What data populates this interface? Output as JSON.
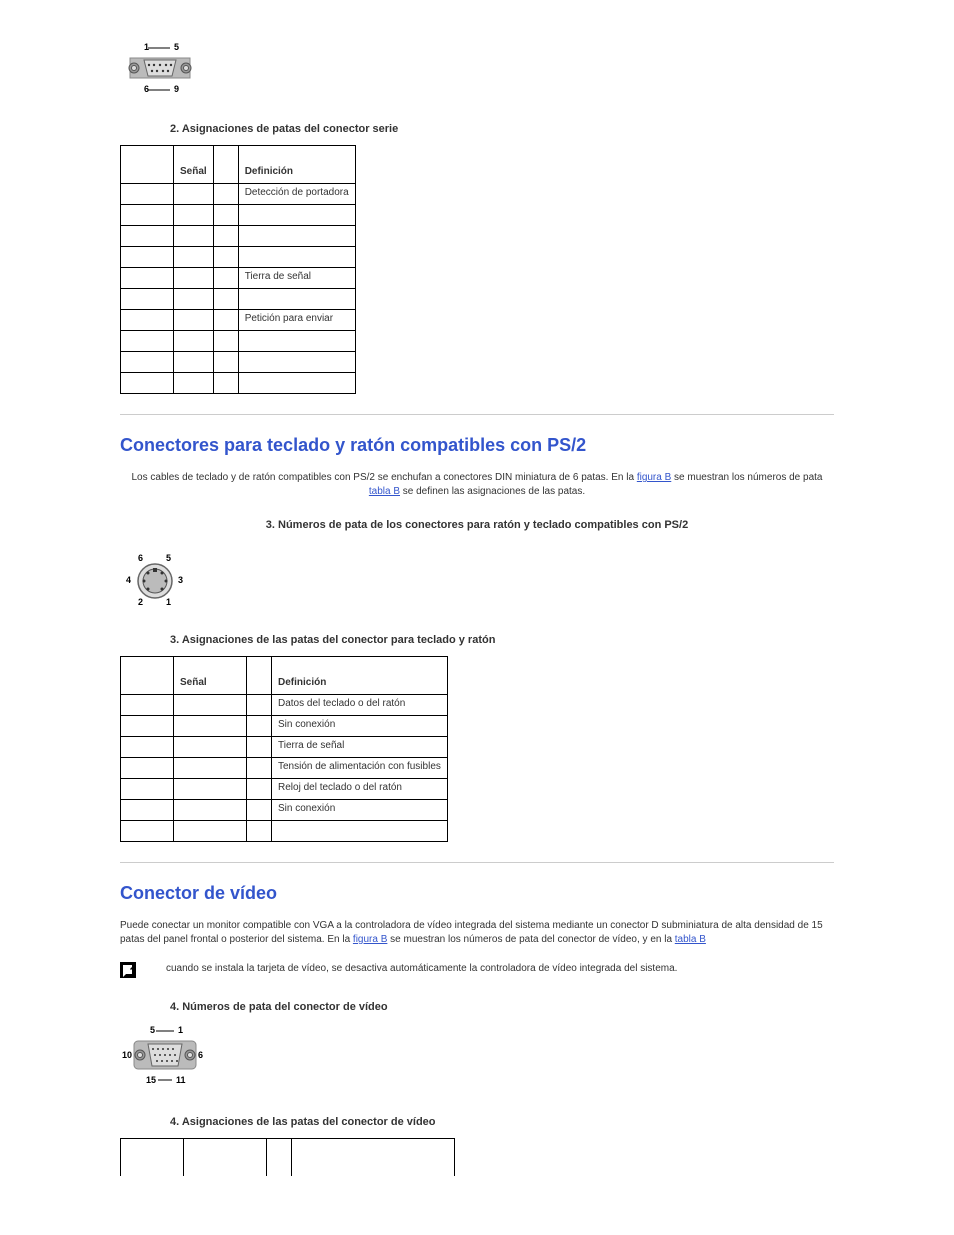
{
  "serial": {
    "caption": "2. Asignaciones de patas del conector serie",
    "table": {
      "headers": {
        "signal": "Señal",
        "definition": "Definición"
      },
      "rows": [
        {
          "signal": "",
          "definition": "Detección de portadora"
        },
        {
          "signal": "",
          "definition": ""
        },
        {
          "signal": "",
          "definition": ""
        },
        {
          "signal": "",
          "definition": ""
        },
        {
          "signal": "",
          "definition": "Tierra de señal"
        },
        {
          "signal": "",
          "definition": ""
        },
        {
          "signal": "",
          "definition": "Petición para enviar"
        },
        {
          "signal": "",
          "definition": ""
        },
        {
          "signal": "",
          "definition": ""
        },
        {
          "signal": "",
          "definition": ""
        }
      ]
    }
  },
  "ps2": {
    "heading": "Conectores para teclado y ratón compatibles con PS/2",
    "intro_a": "Los cables de teclado y de ratón compatibles con PS/2 se enchufan a conectores DIN miniatura de 6 patas. En la ",
    "link1": "figura B",
    "intro_b": " se muestran los números de pata ",
    "link2": "tabla B",
    "intro_c": " se definen las asignaciones de las patas.",
    "fig_caption": "3. Números de pata de los conectores para ratón y teclado compatibles con PS/2",
    "table_caption": "3. Asignaciones de las patas del conector para teclado y ratón",
    "labels": {
      "l1": "1",
      "l2": "2",
      "l3": "3",
      "l4": "4",
      "l5": "5",
      "l6": "6"
    },
    "table": {
      "headers": {
        "signal": "Señal",
        "definition": "Definición"
      },
      "rows": [
        {
          "signal": "",
          "definition": "Datos del teclado o del ratón"
        },
        {
          "signal": "",
          "definition": "Sin conexión"
        },
        {
          "signal": "",
          "definition": "Tierra de señal"
        },
        {
          "signal": "",
          "definition": "Tensión de alimentación con fusibles"
        },
        {
          "signal": "",
          "definition": "Reloj del teclado o del ratón"
        },
        {
          "signal": "",
          "definition": "Sin conexión"
        },
        {
          "signal": "",
          "definition": ""
        }
      ]
    }
  },
  "video": {
    "heading": "Conector de vídeo",
    "intro_a": "Puede conectar un monitor compatible con VGA a la controladora de vídeo integrada del sistema mediante un conector D subminiatura de alta densidad de 15 patas del panel frontal o posterior del sistema. En la ",
    "link1": "figura B",
    "intro_b": " se muestran los números de pata del conector de vídeo, y en la ",
    "link2": "tabla B",
    "note": "cuando se instala la tarjeta de vídeo, se desactiva automáticamente la controladora de vídeo integrada del sistema.",
    "fig_caption": "4. Números de pata del conector de vídeo",
    "table_caption": "4. Asignaciones de las patas del conector de vídeo",
    "labels": {
      "l1": "1",
      "l5": "5",
      "l6": "6",
      "l10": "10",
      "l11": "11",
      "l15": "15"
    }
  }
}
